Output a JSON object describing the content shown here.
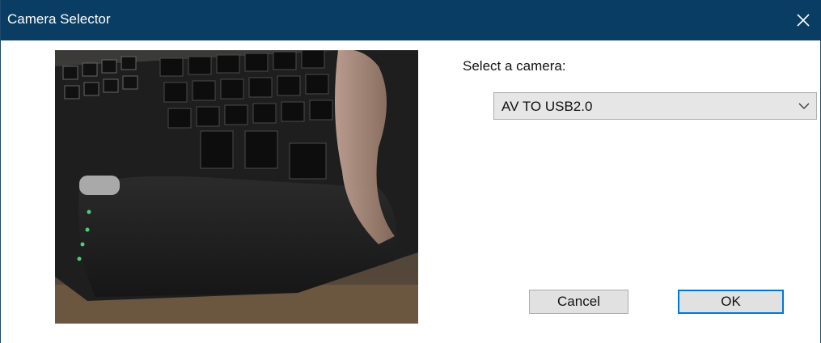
{
  "window": {
    "title": "Camera Selector"
  },
  "preview": {
    "description_icon": "camera-preview-image"
  },
  "camera_select": {
    "label": "Select a camera:",
    "selected_value": "AV TO USB2.0"
  },
  "buttons": {
    "cancel_label": "Cancel",
    "ok_label": "OK"
  },
  "colors": {
    "titlebar": "#0a3d63",
    "combo_bg": "#e6e6e6",
    "button_bg": "#e1e1e1",
    "default_button_border": "#0078d7"
  }
}
